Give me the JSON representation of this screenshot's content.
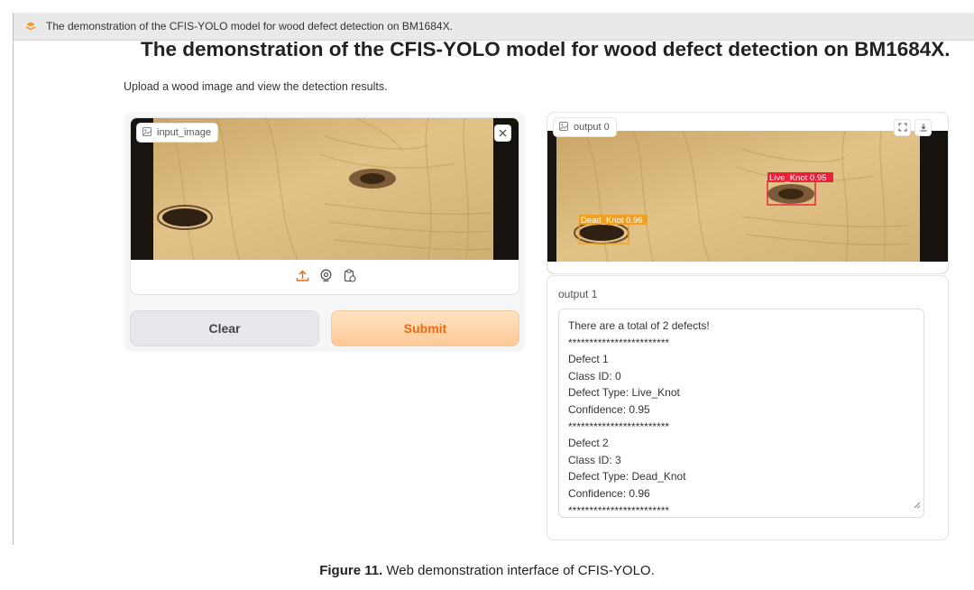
{
  "browser": {
    "tab_title": "The demonstration of the CFIS-YOLO model for wood defect detection on BM1684X."
  },
  "page": {
    "title": "The demonstration of the CFIS-YOLO model for wood defect detection on BM1684X.",
    "description": "Upload a wood image and view the detection results."
  },
  "input_image": {
    "label": "input_image"
  },
  "buttons": {
    "clear": "Clear",
    "submit": "Submit"
  },
  "output0": {
    "label": "output 0",
    "detections": [
      {
        "text": "Live_Knot  0.95",
        "color": "#e8223a"
      },
      {
        "text": "Dead_Knot  0.96",
        "color": "#f0a020"
      }
    ]
  },
  "output1": {
    "label": "output 1",
    "lines": [
      "There are a total of 2 defects!",
      "************************",
      "Defect 1",
      "Class ID: 0",
      "Defect Type: Live_Knot",
      "Confidence: 0.95",
      "************************",
      "Defect 2",
      "Class ID: 3",
      "Defect Type: Dead_Knot",
      "Confidence: 0.96",
      "************************"
    ]
  },
  "caption": {
    "figure": "Figure 11.",
    "text": " Web demonstration interface of CFIS-YOLO."
  },
  "colors": {
    "accent": "#ea6a12",
    "submit_bg": "#fdc996",
    "clear_bg": "#e8e8ec",
    "wood": "#d6b57a"
  },
  "icons": [
    "gradio-tab-icon",
    "image-icon",
    "close-icon",
    "upload-icon",
    "webcam-icon",
    "clipboard-icon",
    "fullscreen-icon",
    "download-icon",
    "resize-grip-icon"
  ]
}
